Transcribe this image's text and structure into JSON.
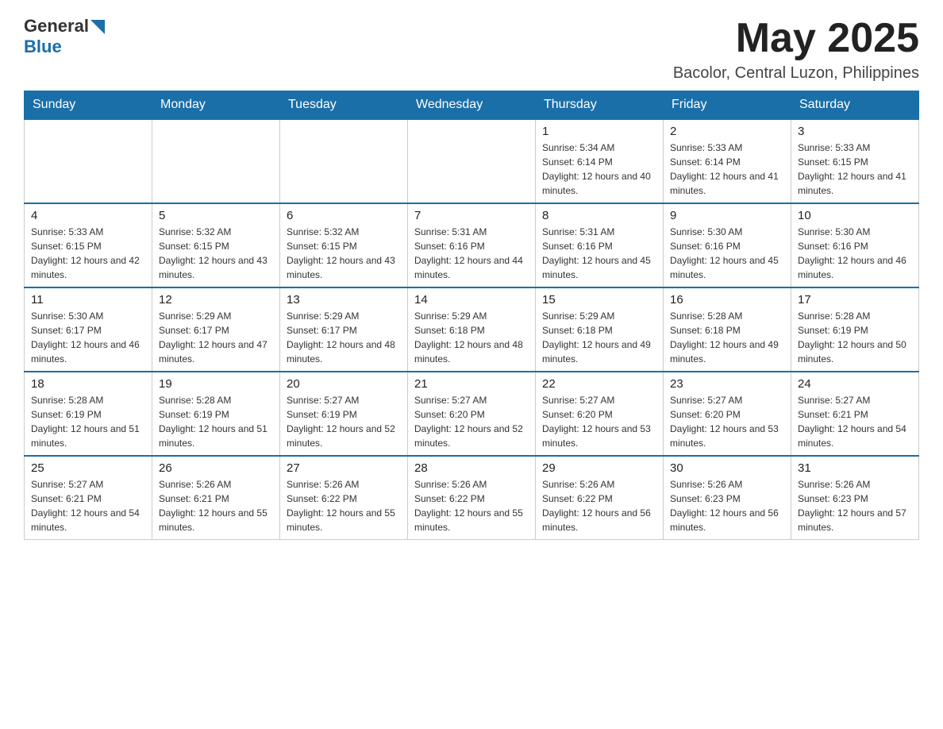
{
  "logo": {
    "general": "General",
    "blue": "Blue"
  },
  "title": {
    "month_year": "May 2025",
    "location": "Bacolor, Central Luzon, Philippines"
  },
  "days_of_week": [
    "Sunday",
    "Monday",
    "Tuesday",
    "Wednesday",
    "Thursday",
    "Friday",
    "Saturday"
  ],
  "weeks": [
    [
      {
        "day": "",
        "sunrise": "",
        "sunset": "",
        "daylight": ""
      },
      {
        "day": "",
        "sunrise": "",
        "sunset": "",
        "daylight": ""
      },
      {
        "day": "",
        "sunrise": "",
        "sunset": "",
        "daylight": ""
      },
      {
        "day": "",
        "sunrise": "",
        "sunset": "",
        "daylight": ""
      },
      {
        "day": "1",
        "sunrise": "Sunrise: 5:34 AM",
        "sunset": "Sunset: 6:14 PM",
        "daylight": "Daylight: 12 hours and 40 minutes."
      },
      {
        "day": "2",
        "sunrise": "Sunrise: 5:33 AM",
        "sunset": "Sunset: 6:14 PM",
        "daylight": "Daylight: 12 hours and 41 minutes."
      },
      {
        "day": "3",
        "sunrise": "Sunrise: 5:33 AM",
        "sunset": "Sunset: 6:15 PM",
        "daylight": "Daylight: 12 hours and 41 minutes."
      }
    ],
    [
      {
        "day": "4",
        "sunrise": "Sunrise: 5:33 AM",
        "sunset": "Sunset: 6:15 PM",
        "daylight": "Daylight: 12 hours and 42 minutes."
      },
      {
        "day": "5",
        "sunrise": "Sunrise: 5:32 AM",
        "sunset": "Sunset: 6:15 PM",
        "daylight": "Daylight: 12 hours and 43 minutes."
      },
      {
        "day": "6",
        "sunrise": "Sunrise: 5:32 AM",
        "sunset": "Sunset: 6:15 PM",
        "daylight": "Daylight: 12 hours and 43 minutes."
      },
      {
        "day": "7",
        "sunrise": "Sunrise: 5:31 AM",
        "sunset": "Sunset: 6:16 PM",
        "daylight": "Daylight: 12 hours and 44 minutes."
      },
      {
        "day": "8",
        "sunrise": "Sunrise: 5:31 AM",
        "sunset": "Sunset: 6:16 PM",
        "daylight": "Daylight: 12 hours and 45 minutes."
      },
      {
        "day": "9",
        "sunrise": "Sunrise: 5:30 AM",
        "sunset": "Sunset: 6:16 PM",
        "daylight": "Daylight: 12 hours and 45 minutes."
      },
      {
        "day": "10",
        "sunrise": "Sunrise: 5:30 AM",
        "sunset": "Sunset: 6:16 PM",
        "daylight": "Daylight: 12 hours and 46 minutes."
      }
    ],
    [
      {
        "day": "11",
        "sunrise": "Sunrise: 5:30 AM",
        "sunset": "Sunset: 6:17 PM",
        "daylight": "Daylight: 12 hours and 46 minutes."
      },
      {
        "day": "12",
        "sunrise": "Sunrise: 5:29 AM",
        "sunset": "Sunset: 6:17 PM",
        "daylight": "Daylight: 12 hours and 47 minutes."
      },
      {
        "day": "13",
        "sunrise": "Sunrise: 5:29 AM",
        "sunset": "Sunset: 6:17 PM",
        "daylight": "Daylight: 12 hours and 48 minutes."
      },
      {
        "day": "14",
        "sunrise": "Sunrise: 5:29 AM",
        "sunset": "Sunset: 6:18 PM",
        "daylight": "Daylight: 12 hours and 48 minutes."
      },
      {
        "day": "15",
        "sunrise": "Sunrise: 5:29 AM",
        "sunset": "Sunset: 6:18 PM",
        "daylight": "Daylight: 12 hours and 49 minutes."
      },
      {
        "day": "16",
        "sunrise": "Sunrise: 5:28 AM",
        "sunset": "Sunset: 6:18 PM",
        "daylight": "Daylight: 12 hours and 49 minutes."
      },
      {
        "day": "17",
        "sunrise": "Sunrise: 5:28 AM",
        "sunset": "Sunset: 6:19 PM",
        "daylight": "Daylight: 12 hours and 50 minutes."
      }
    ],
    [
      {
        "day": "18",
        "sunrise": "Sunrise: 5:28 AM",
        "sunset": "Sunset: 6:19 PM",
        "daylight": "Daylight: 12 hours and 51 minutes."
      },
      {
        "day": "19",
        "sunrise": "Sunrise: 5:28 AM",
        "sunset": "Sunset: 6:19 PM",
        "daylight": "Daylight: 12 hours and 51 minutes."
      },
      {
        "day": "20",
        "sunrise": "Sunrise: 5:27 AM",
        "sunset": "Sunset: 6:19 PM",
        "daylight": "Daylight: 12 hours and 52 minutes."
      },
      {
        "day": "21",
        "sunrise": "Sunrise: 5:27 AM",
        "sunset": "Sunset: 6:20 PM",
        "daylight": "Daylight: 12 hours and 52 minutes."
      },
      {
        "day": "22",
        "sunrise": "Sunrise: 5:27 AM",
        "sunset": "Sunset: 6:20 PM",
        "daylight": "Daylight: 12 hours and 53 minutes."
      },
      {
        "day": "23",
        "sunrise": "Sunrise: 5:27 AM",
        "sunset": "Sunset: 6:20 PM",
        "daylight": "Daylight: 12 hours and 53 minutes."
      },
      {
        "day": "24",
        "sunrise": "Sunrise: 5:27 AM",
        "sunset": "Sunset: 6:21 PM",
        "daylight": "Daylight: 12 hours and 54 minutes."
      }
    ],
    [
      {
        "day": "25",
        "sunrise": "Sunrise: 5:27 AM",
        "sunset": "Sunset: 6:21 PM",
        "daylight": "Daylight: 12 hours and 54 minutes."
      },
      {
        "day": "26",
        "sunrise": "Sunrise: 5:26 AM",
        "sunset": "Sunset: 6:21 PM",
        "daylight": "Daylight: 12 hours and 55 minutes."
      },
      {
        "day": "27",
        "sunrise": "Sunrise: 5:26 AM",
        "sunset": "Sunset: 6:22 PM",
        "daylight": "Daylight: 12 hours and 55 minutes."
      },
      {
        "day": "28",
        "sunrise": "Sunrise: 5:26 AM",
        "sunset": "Sunset: 6:22 PM",
        "daylight": "Daylight: 12 hours and 55 minutes."
      },
      {
        "day": "29",
        "sunrise": "Sunrise: 5:26 AM",
        "sunset": "Sunset: 6:22 PM",
        "daylight": "Daylight: 12 hours and 56 minutes."
      },
      {
        "day": "30",
        "sunrise": "Sunrise: 5:26 AM",
        "sunset": "Sunset: 6:23 PM",
        "daylight": "Daylight: 12 hours and 56 minutes."
      },
      {
        "day": "31",
        "sunrise": "Sunrise: 5:26 AM",
        "sunset": "Sunset: 6:23 PM",
        "daylight": "Daylight: 12 hours and 57 minutes."
      }
    ]
  ]
}
